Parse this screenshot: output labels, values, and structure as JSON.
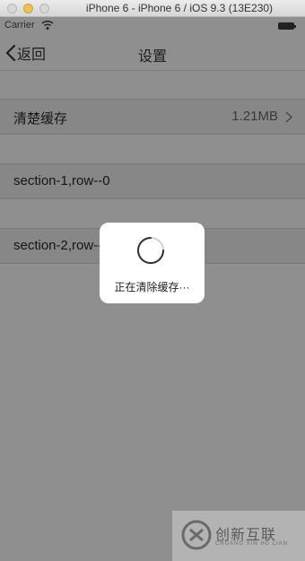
{
  "window": {
    "title": "iPhone 6 - iPhone 6 / iOS 9.3 (13E230)"
  },
  "status_bar": {
    "carrier": "Carrier"
  },
  "nav": {
    "back_label": "返回",
    "title": "设置"
  },
  "rows": [
    {
      "label": "清楚缓存",
      "detail": "1.21MB"
    },
    {
      "label": "section-1,row--0"
    },
    {
      "label": "section-2,row--0"
    }
  ],
  "hud": {
    "message": "正在清除缓存···"
  },
  "watermark": {
    "name": "创新互联",
    "sub": "CHUANG XIN HU LIAN"
  }
}
